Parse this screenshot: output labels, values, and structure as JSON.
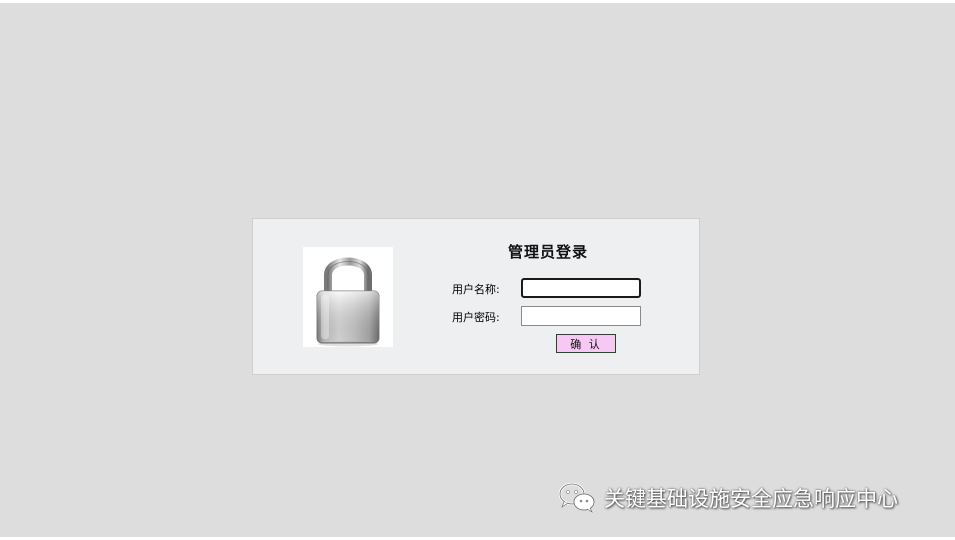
{
  "login": {
    "title": "管理员登录",
    "username_label": "用户名称:",
    "password_label": "用户密码:",
    "username_value": "",
    "password_value": "",
    "confirm_label": "确 认"
  },
  "icons": {
    "lock": "padlock-icon",
    "watermark": "wechat-logo-icon"
  },
  "watermark": {
    "text": "关键基础设施安全应急响应中心"
  },
  "colors": {
    "page_background": "#dddddd",
    "panel_background": "#eeeff0",
    "button_background": "#f7c8f3"
  }
}
